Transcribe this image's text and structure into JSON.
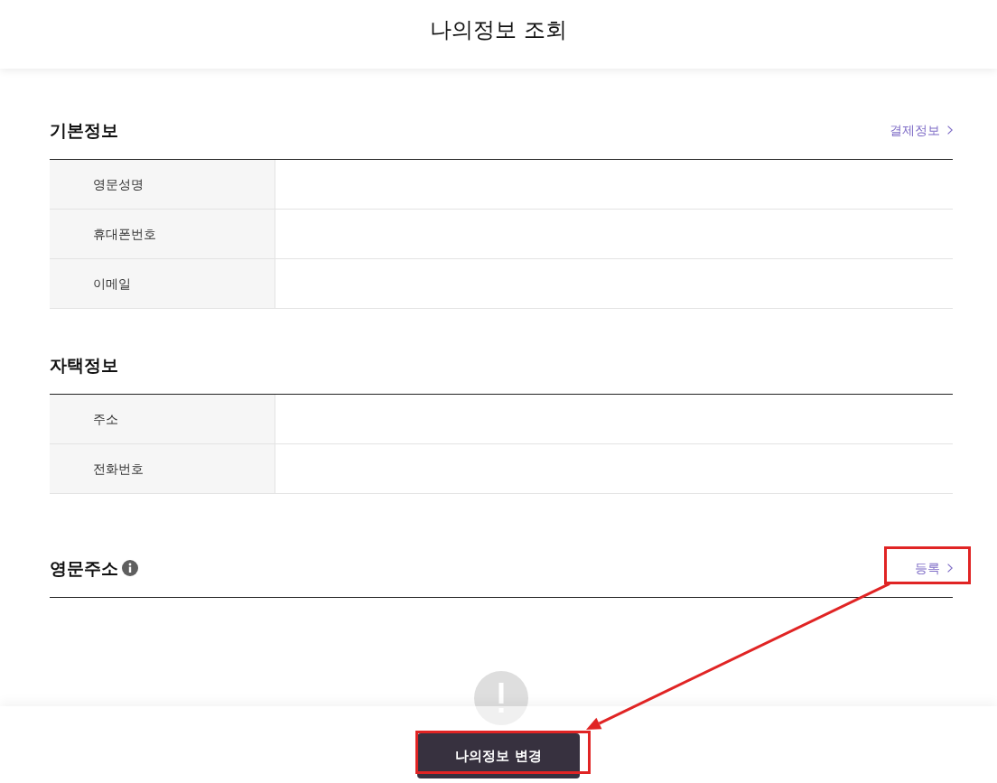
{
  "header": {
    "title": "나의정보 조회"
  },
  "sections": [
    {
      "title": "기본정보",
      "link": {
        "label": "결제정보"
      },
      "rows": [
        {
          "label": "영문성명"
        },
        {
          "label": "휴대폰번호"
        },
        {
          "label": "이메일"
        }
      ]
    },
    {
      "title": "자택정보",
      "rows": [
        {
          "label": "주소"
        },
        {
          "label": "전화번호"
        }
      ]
    },
    {
      "title": "영문주소",
      "info_icon": true,
      "link": {
        "label": "등록",
        "highlighted": true
      }
    }
  ],
  "footer": {
    "button": {
      "label": "나의정보 변경",
      "highlighted": true
    }
  },
  "annotation_arrow": true
}
